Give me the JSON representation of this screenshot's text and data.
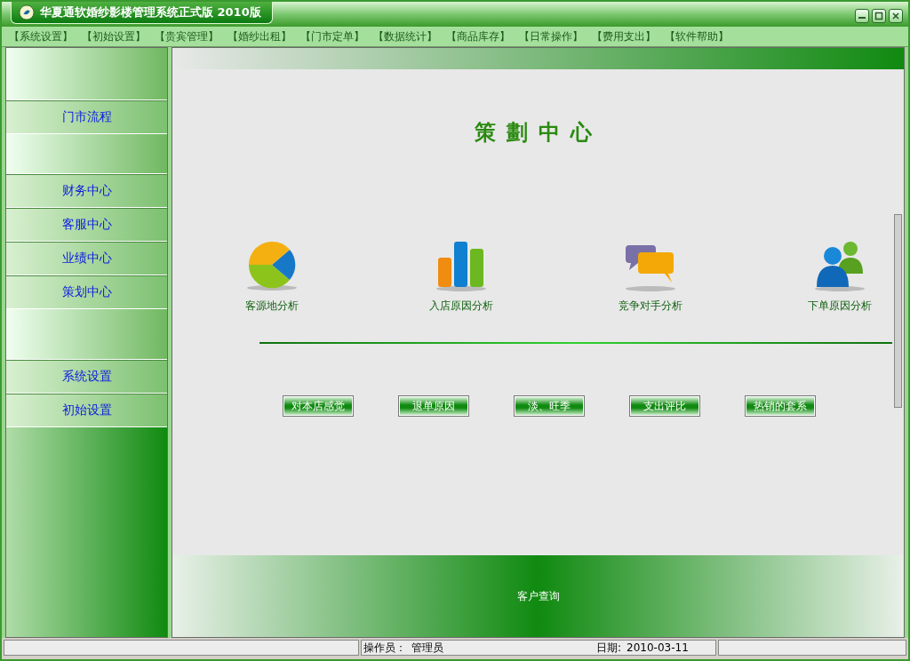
{
  "window": {
    "title": "华夏通软婚纱影楼管理系统正式版 2010版"
  },
  "menu": [
    "【系统设置】",
    "【初始设置】",
    "【贵宾管理】",
    "【婚纱出租】",
    "【门市定单】",
    "【数据统计】",
    "【商品库存】",
    "【日常操作】",
    "【费用支出】",
    "【软件帮助】"
  ],
  "sidebar": {
    "items": [
      {
        "kind": "spacer"
      },
      {
        "kind": "link",
        "label": "门市流程"
      },
      {
        "kind": "spacer"
      },
      {
        "kind": "link",
        "label": "财务中心"
      },
      {
        "kind": "link",
        "label": "客服中心"
      },
      {
        "kind": "link",
        "label": "业绩中心"
      },
      {
        "kind": "link",
        "label": "策划中心"
      },
      {
        "kind": "tall"
      },
      {
        "kind": "link",
        "label": "系统设置"
      },
      {
        "kind": "link",
        "label": "初始设置"
      }
    ]
  },
  "main": {
    "heading": "策劃中心",
    "analyses": [
      {
        "kind": "pie",
        "label": "客源地分析"
      },
      {
        "kind": "bars",
        "label": "入店原因分析"
      },
      {
        "kind": "chat",
        "label": "竞争对手分析"
      },
      {
        "kind": "people",
        "label": "下单原因分析"
      }
    ],
    "buttons": [
      "对本店感觉",
      "退单原因",
      "淡、旺季",
      "支出评比",
      "热销的套系"
    ],
    "footer_link": "客户查询"
  },
  "status_bar": {
    "operator_label": "操作员：",
    "operator": "管理员",
    "date_label": "日期:",
    "date": "2010-03-11"
  }
}
